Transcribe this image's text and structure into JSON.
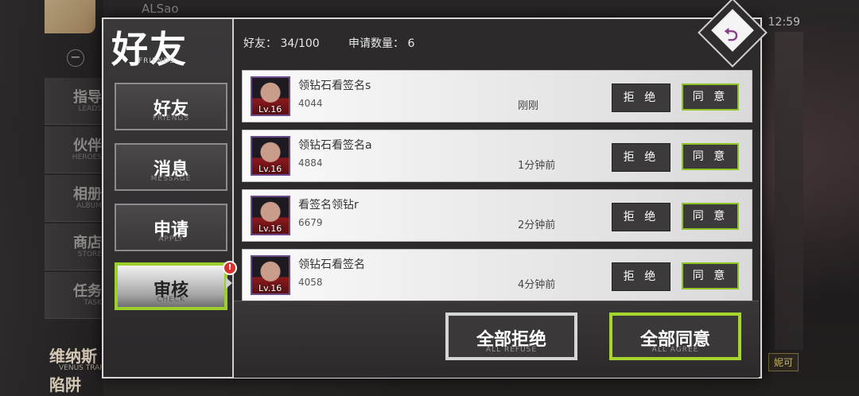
{
  "background": {
    "username": "ALSao",
    "time": "12:59",
    "menu": [
      {
        "cn": "指导",
        "en": "LEADS"
      },
      {
        "cn": "伙伴",
        "en": "HEROES"
      },
      {
        "cn": "相册",
        "en": "ALBUM"
      },
      {
        "cn": "商店",
        "en": "STORE"
      },
      {
        "cn": "任务",
        "en": "TASK"
      }
    ],
    "banner_line1": "维纳斯",
    "banner_en": "VENUS TRAP",
    "banner_line2": "陷阱",
    "corner_label": "妮可"
  },
  "dialog": {
    "title_cn": "好友",
    "title_en": "FRIENDS",
    "tabs": [
      {
        "cn": "好友",
        "en": "FRIENDS"
      },
      {
        "cn": "消息",
        "en": "MESSAGE"
      },
      {
        "cn": "申请",
        "en": "APPLY"
      },
      {
        "cn": "审核",
        "en": "CHECK"
      }
    ],
    "alert_badge": "!",
    "friends_count": "好友：  34/100",
    "request_count": "申请数量：  6",
    "back_icon": "⮌",
    "requests": [
      {
        "name": "领钻石看签名s",
        "uid": "4044",
        "time": "刚刚",
        "level": "Lv.16"
      },
      {
        "name": "领钻石看签名a",
        "uid": "4884",
        "time": "1分钟前",
        "level": "Lv.16"
      },
      {
        "name": "看签名领钻r",
        "uid": "6679",
        "time": "2分钟前",
        "level": "Lv.16"
      },
      {
        "name": "领钻石看签名",
        "uid": "4058",
        "time": "4分钟前",
        "level": "Lv.16"
      }
    ],
    "reject_label": "拒 绝",
    "agree_label": "同 意",
    "reject_all": {
      "cn": "全部拒绝",
      "en": "ALL REFUSE"
    },
    "agree_all": {
      "cn": "全部同意",
      "en": "ALL AGREE"
    }
  },
  "colors": {
    "accent_green": "#9ccf2e",
    "alert_red": "#d8322e",
    "back_icon_purple": "#8a3a8a"
  }
}
